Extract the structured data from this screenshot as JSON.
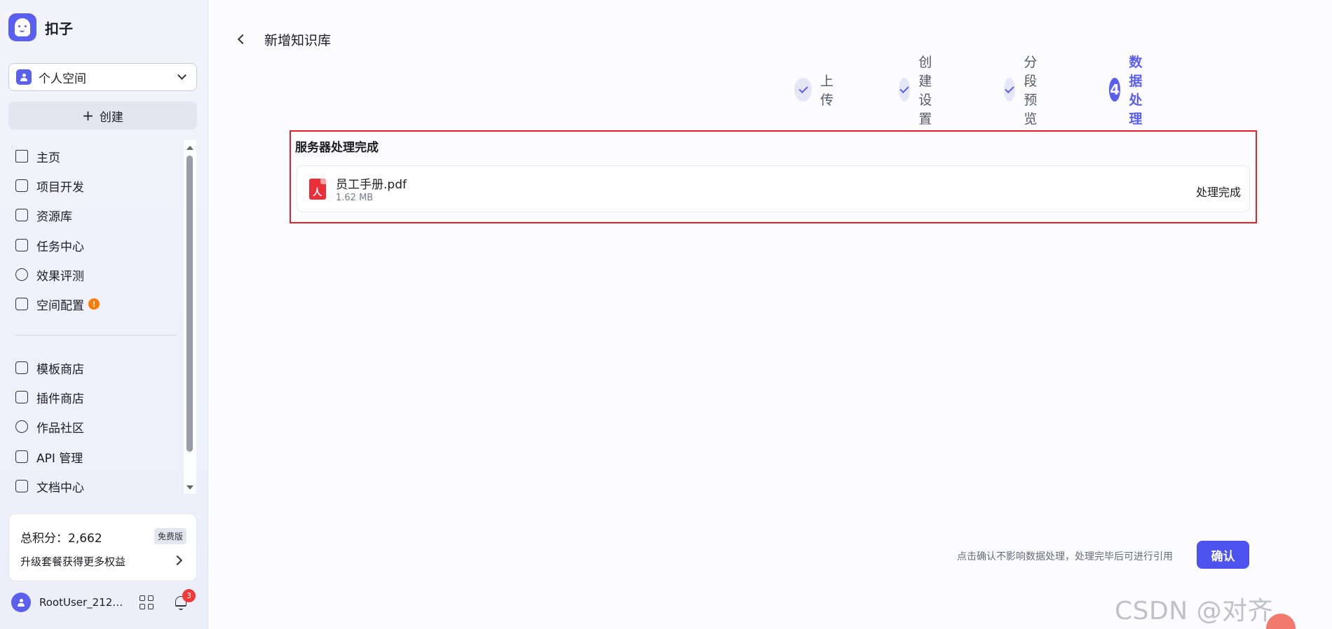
{
  "brand": {
    "name": "扣子"
  },
  "space": {
    "label": "个人空间"
  },
  "create_button": {
    "label": "创建"
  },
  "nav": {
    "items": [
      {
        "label": "主页",
        "icon": "home-icon"
      },
      {
        "label": "项目开发",
        "icon": "robot-icon"
      },
      {
        "label": "资源库",
        "icon": "library-icon"
      },
      {
        "label": "任务中心",
        "icon": "task-icon"
      },
      {
        "label": "效果评测",
        "icon": "gauge-icon"
      },
      {
        "label": "空间配置",
        "icon": "terminal-icon",
        "badge": "!"
      },
      {
        "label": "模板商店",
        "icon": "template-icon"
      },
      {
        "label": "插件商店",
        "icon": "plugin-icon"
      },
      {
        "label": "作品社区",
        "icon": "planet-icon"
      },
      {
        "label": "API 管理",
        "icon": "link-icon"
      },
      {
        "label": "文档中心",
        "icon": "document-icon"
      }
    ]
  },
  "credits": {
    "label": "总积分：2,662",
    "plan_badge": "免费版",
    "upgrade_text": "升级套餐获得更多权益"
  },
  "user": {
    "name": "RootUser_212…",
    "notification_count": "3"
  },
  "header": {
    "title": "新增知识库"
  },
  "steps": [
    {
      "label": "上传",
      "state": "done"
    },
    {
      "label": "创建设置",
      "state": "done"
    },
    {
      "label": "分段预览",
      "state": "done"
    },
    {
      "label": "数据处理",
      "state": "active",
      "number": "4"
    }
  ],
  "result": {
    "title": "服务器处理完成",
    "file": {
      "name": "员工手册.pdf",
      "size": "1.62 MB",
      "status": "处理完成"
    }
  },
  "footer": {
    "hint": "点击确认不影响数据处理，处理完毕后可进行引用",
    "confirm_label": "确认"
  },
  "watermark": "CSDN @对齐token",
  "colors": {
    "accent": "#5b5ff0",
    "highlight_border": "#e0202a",
    "pdf_red": "#ea2f39",
    "warning": "#ff7a00",
    "notification": "#f03a3a"
  }
}
